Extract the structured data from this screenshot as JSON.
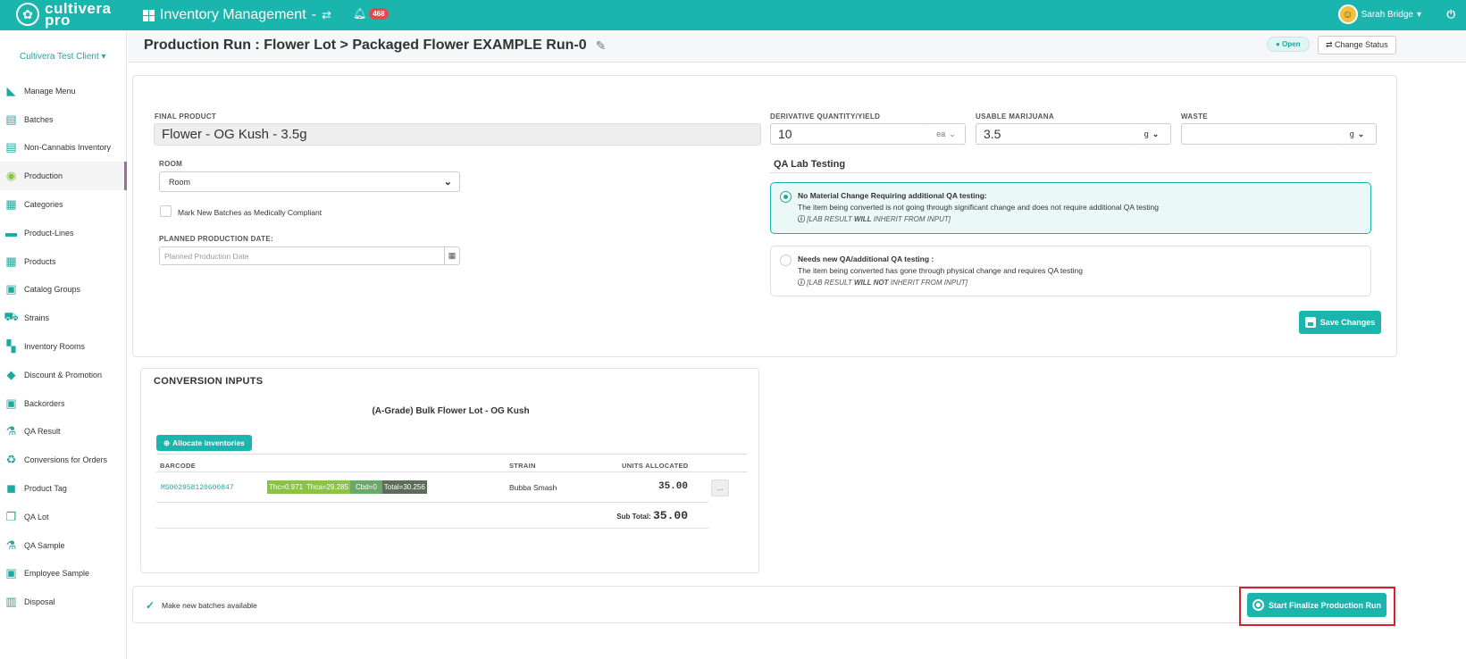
{
  "topbar": {
    "logo_line1": "cultivera",
    "logo_line2": "pro",
    "app_menu": "Inventory Management",
    "app_menu_caret": "-",
    "notification_count": "468",
    "user_name": "Sarah Bridge",
    "user_caret": "▾"
  },
  "sidebar": {
    "client": "Cultivera Test Client",
    "items": [
      {
        "label": "Manage Menu",
        "icon": "book-icon"
      },
      {
        "label": "Batches",
        "icon": "batches-icon"
      },
      {
        "label": "Non-Cannabis Inventory",
        "icon": "inventory-icon"
      },
      {
        "label": "Production",
        "icon": "production-icon"
      },
      {
        "label": "Categories",
        "icon": "categories-icon"
      },
      {
        "label": "Product-Lines",
        "icon": "product-lines-icon"
      },
      {
        "label": "Products",
        "icon": "products-icon"
      },
      {
        "label": "Catalog Groups",
        "icon": "catalog-icon"
      },
      {
        "label": "Strains",
        "icon": "strains-icon"
      },
      {
        "label": "Inventory Rooms",
        "icon": "rooms-icon"
      },
      {
        "label": "Discount & Promotion",
        "icon": "tags-icon"
      },
      {
        "label": "Backorders",
        "icon": "backorders-icon"
      },
      {
        "label": "QA Result",
        "icon": "flask-icon"
      },
      {
        "label": "Conversions for Orders",
        "icon": "recycle-icon"
      },
      {
        "label": "Product Tag",
        "icon": "tag-icon"
      },
      {
        "label": "QA Lot",
        "icon": "qa-lot-icon"
      },
      {
        "label": "QA Sample",
        "icon": "flask-icon"
      },
      {
        "label": "Employee Sample",
        "icon": "employee-icon"
      },
      {
        "label": "Disposal",
        "icon": "trash-icon"
      }
    ]
  },
  "header": {
    "title": "Production Run : Flower Lot > Packaged Flower EXAMPLE Run-0",
    "status": "Open",
    "change_status": "Change Status"
  },
  "form": {
    "final_product_label": "FINAL PRODUCT",
    "final_product_value": "Flower - OG Kush  - 3.5g",
    "room_label": "ROOM",
    "room_value": "Room",
    "medically_compliant_label": "Mark New Batches as Medically Compliant",
    "planned_date_label": "PLANNED PRODUCTION DATE:",
    "planned_date_placeholder": "Planned Production Date",
    "derivative_label": "DERIVATIVE QUANTITY/YIELD",
    "derivative_value": "10",
    "derivative_unit": "ea",
    "usable_label": "USABLE MARIJUANA",
    "usable_value": "3.5",
    "usable_unit": "g",
    "waste_label": "WASTE",
    "waste_value": "",
    "waste_unit": "g",
    "qa_title": "QA Lab Testing",
    "qa_option1": {
      "heading": "No Material Change Requiring additional QA testing:",
      "desc": "The item being converted is not going through significant change and does not require additional QA testing",
      "note_prefix": "[LAB RESULT ",
      "note_bold": "WILL",
      "note_suffix": " INHERIT FROM INPUT]"
    },
    "qa_option2": {
      "heading": "Needs new QA/additional QA testing :",
      "desc": "The item being converted has gone through physical change and requires QA testing",
      "note_prefix": "[LAB RESULT ",
      "note_bold": "WILL NOT",
      "note_suffix": " INHERIT FROM INPUT]"
    },
    "save_label": "Save Changes"
  },
  "conversion": {
    "title": "CONVERSION INPUTS",
    "subtitle": "(A-Grade) Bulk Flower Lot - OG Kush",
    "allocate_label": "Allocate inventories",
    "columns": {
      "barcode": "BARCODE",
      "strain": "STRAIN",
      "units": "UNITS ALLOCATED"
    },
    "row": {
      "barcode": "MS002958120600847",
      "thc": "Thc=0.971",
      "thca": "Thca=29.285",
      "cbd": "Cbd=0",
      "total": "Total=30.256",
      "strain": "Bubba Smash",
      "units": "35.00",
      "more": "..."
    },
    "subtotal_label": "Sub Total:",
    "subtotal_value": "35.00"
  },
  "bottom": {
    "available_label": "Make new batches available",
    "finalize_label": "Start Finalize Production Run"
  },
  "colors": {
    "accent": "#1ab5ad",
    "highlight": "#d9202a",
    "badge": "#e8474c"
  }
}
